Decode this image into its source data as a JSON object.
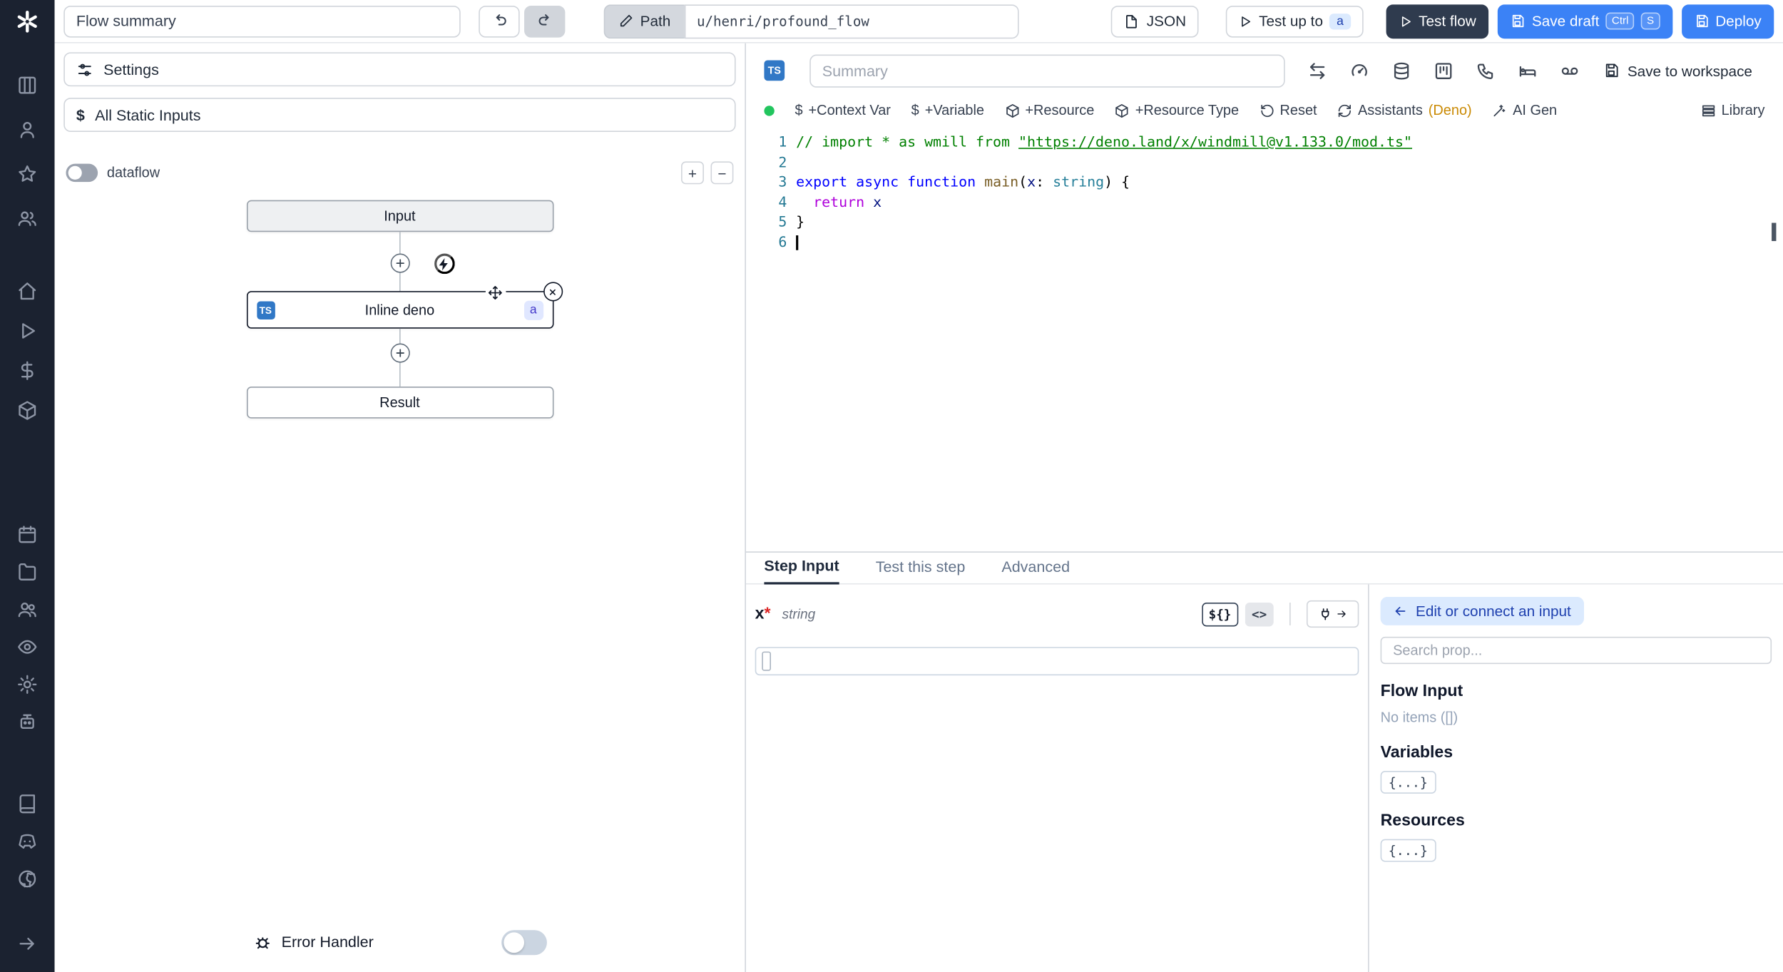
{
  "topbar": {
    "flow_summary_value": "Flow summary",
    "path_label": "Path",
    "path_value": "u/henri/profound_flow",
    "json_label": "JSON",
    "test_up_to_label": "Test up to",
    "test_up_to_badge": "a",
    "test_flow_label": "Test flow",
    "save_draft_label": "Save draft",
    "save_kbd": [
      "Ctrl",
      "S"
    ],
    "deploy_label": "Deploy"
  },
  "sidebar": {
    "icon_names": [
      "windmill-logo",
      "table",
      "user",
      "star",
      "user-group",
      "home",
      "play",
      "dollar",
      "package",
      "calendar",
      "folder",
      "users",
      "eye",
      "settings-gear",
      "robot",
      "book",
      "discord",
      "github",
      "collapse-arrow"
    ]
  },
  "flow": {
    "settings_label": "Settings",
    "static_inputs_label": "All Static Inputs",
    "static_inputs_icon": "$",
    "dataflow_label": "dataflow",
    "zoom_in_label": "+",
    "zoom_out_label": "−",
    "input_node": "Input",
    "step_node": "Inline deno",
    "step_lang": "TS",
    "step_badge": "a",
    "result_node": "Result",
    "error_handler_label": "Error Handler"
  },
  "editor": {
    "lang_badge": "TS",
    "summary_placeholder": "Summary",
    "save_to_workspace_label": "Save to workspace",
    "toolbar": {
      "dollar_icon": "$",
      "context_var": "+Context Var",
      "variable": "+Variable",
      "resource": "+Resource",
      "resource_type": "+Resource Type",
      "reset": "Reset",
      "assistants": "Assistants",
      "assistants_lang": "(Deno)",
      "ai_gen": "AI Gen",
      "library": "Library"
    },
    "code_lines": [
      {
        "num": "1",
        "tokens": [
          [
            "// import * as wmill from ",
            "tok-comment"
          ],
          [
            "\"https://deno.land/x/windmill@v1.133.0/mod.ts\"",
            "tok-comment tok-link"
          ]
        ]
      },
      {
        "num": "2",
        "tokens": []
      },
      {
        "num": "3",
        "tokens": [
          [
            "export ",
            "tok-kw"
          ],
          [
            "async ",
            "tok-kw"
          ],
          [
            "function ",
            "tok-kw"
          ],
          [
            "main",
            "tok-fn"
          ],
          [
            "(",
            "tok-plain"
          ],
          [
            "x",
            "tok-param"
          ],
          [
            ": ",
            "tok-plain"
          ],
          [
            "string",
            "tok-type"
          ],
          [
            ") {",
            "tok-plain"
          ]
        ]
      },
      {
        "num": "4",
        "tokens": [
          [
            "  ",
            "tok-plain"
          ],
          [
            "return",
            "tok-kw2"
          ],
          [
            " ",
            "tok-plain"
          ],
          [
            "x",
            "tok-param"
          ]
        ]
      },
      {
        "num": "5",
        "tokens": [
          [
            "}",
            "tok-plain"
          ]
        ]
      },
      {
        "num": "6",
        "tokens": [],
        "cursor": true
      }
    ]
  },
  "step": {
    "tabs": [
      "Step Input",
      "Test this step",
      "Advanced"
    ],
    "arg_name": "x",
    "required_mark": "*",
    "arg_type": "string",
    "expr_button": "${}",
    "code_button": "<>"
  },
  "props": {
    "connect_label": "Edit or connect an input",
    "search_placeholder": "Search prop...",
    "flow_input_title": "Flow Input",
    "flow_input_empty": "No items ([])",
    "variables_title": "Variables",
    "resources_title": "Resources",
    "object_chip": "{...}"
  },
  "colors": {
    "accent_blue": "#3b82f6",
    "dark_button": "#2f3b4e",
    "sidebar_bg": "#1b2230",
    "status_green": "#22c55e",
    "ts_badge_blue": "#3178c6",
    "deno_tag": "#ca8a04"
  }
}
